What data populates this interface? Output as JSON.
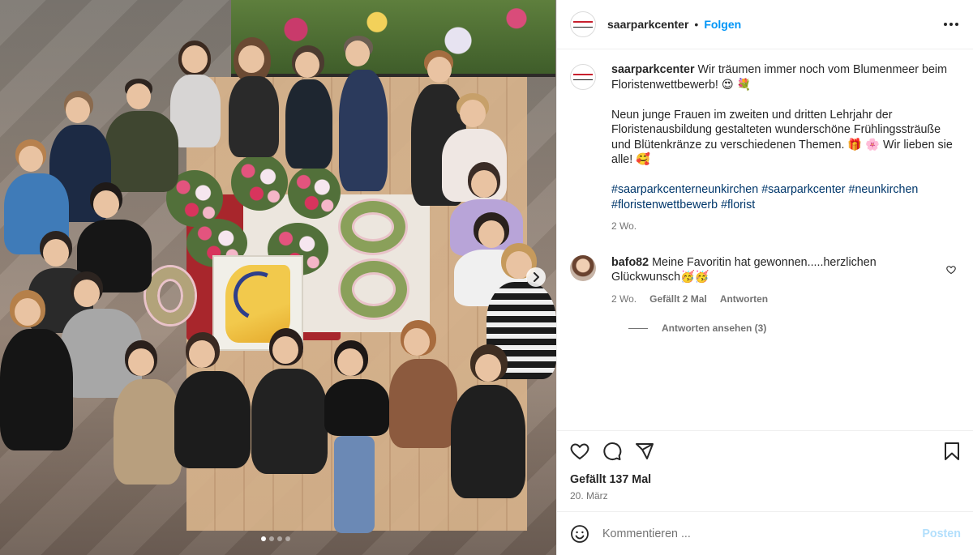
{
  "post": {
    "username": "saarparkcenter",
    "follow_label": "Folgen",
    "caption_line1": "Wir träumen immer noch vom Blumenmeer beim Floristenwettbewerb! 😍 💐",
    "caption_line2": "Neun junge Frauen im zweiten und dritten Lehrjahr der Floristenausbildung gestalteten wunderschöne Frühlingssträuße und Blütenkränze zu verschiedenen Themen. 🎁 🌸 Wir lieben sie alle! 🥰",
    "hashtags": [
      "#saarparkcenterneunkirchen",
      "#saarparkcenter",
      "#neunkirchen",
      "#floristenwettbewerb",
      "#florist"
    ],
    "time_ago": "2 Wo.",
    "likes_label": "Gefällt 137 Mal",
    "date": "20. März"
  },
  "comment": {
    "username": "bafo82",
    "text": "Meine Favoritin hat gewonnen.....herzlichen Glückwunsch🥳🥳",
    "time_ago": "2 Wo.",
    "likes": "Gefällt 2 Mal",
    "reply_label": "Antworten",
    "view_replies": "Antworten ansehen (3)"
  },
  "composer": {
    "placeholder": "Kommentieren ...",
    "post_label": "Posten"
  },
  "carousel": {
    "slide_count": 4,
    "active_index": 0
  },
  "icons": {
    "header_more": "more-horizontal-icon",
    "like": "heart-icon",
    "comment": "comment-bubble-icon",
    "share": "paper-plane-icon",
    "save": "bookmark-icon",
    "emoji": "smiley-icon",
    "next": "chevron-right-icon"
  },
  "colors": {
    "accent": "#0095f6",
    "post_disabled": "#b2dffc",
    "hashtag": "#00376b",
    "muted": "#737373"
  }
}
